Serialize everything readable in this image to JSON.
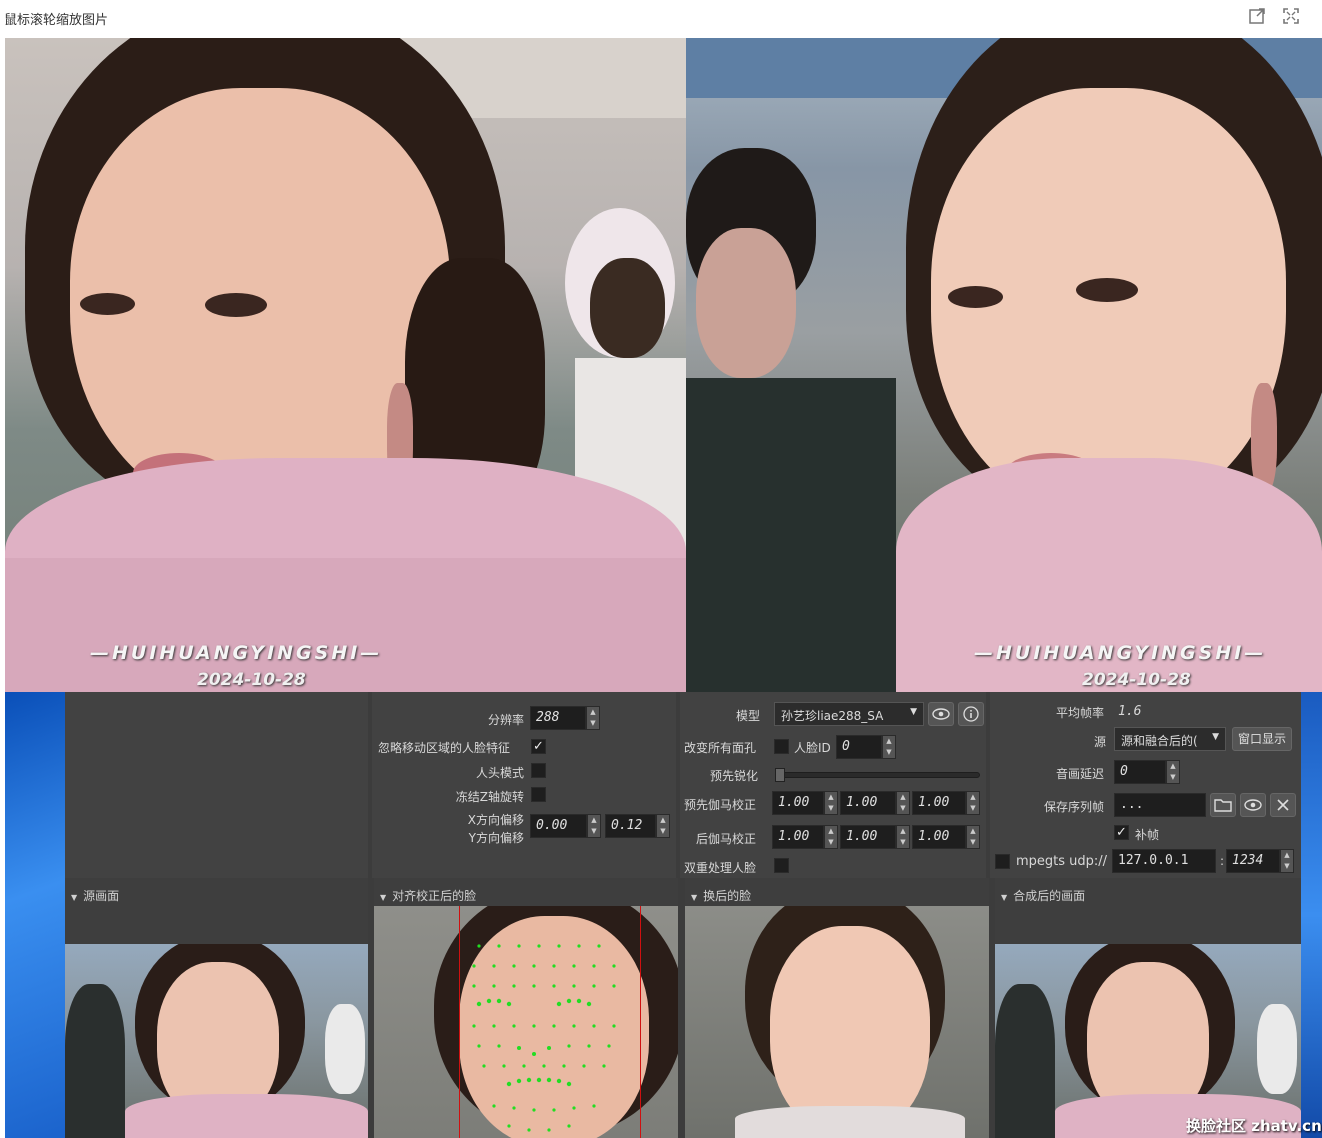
{
  "page": {
    "title": "鼠标滚轮缩放图片"
  },
  "toolbar": {
    "open_icon": "open-external-icon",
    "fullscreen_icon": "fullscreen-icon"
  },
  "preview": {
    "left": {
      "watermark": "—HUIHUANGYINGSHI—",
      "date": "2024-10-28"
    },
    "right": {
      "watermark": "—HUIHUANGYINGSHI—",
      "date": "2024-10-28"
    }
  },
  "settings": {
    "resolution_label": "分辨率",
    "resolution_value": "288",
    "ignore_moving_label": "忽略移动区域的人脸特征",
    "ignore_moving_checked": "✓",
    "head_mode_label": "人头模式",
    "freeze_z_label": "冻结Z轴旋转",
    "x_offset_label": "X方向偏移",
    "y_offset_label": "Y方向偏移",
    "x_offset_value": "0.00",
    "y_offset_value": "0.12",
    "model_label": "模型",
    "model_value": "孙艺珍liae288_SA",
    "change_pupil_label": "改变所有面孔",
    "face_id_label": "人脸ID",
    "face_id_value": "0",
    "pre_sharpen_label": "预先锐化",
    "pre_gamma_label": "预先伽马校正",
    "pre_gamma_values": [
      "1.00",
      "1.00",
      "1.00"
    ],
    "post_gamma_label": "后伽马校正",
    "post_gamma_values": [
      "1.00",
      "1.00",
      "1.00"
    ],
    "dual_process_label": "双重处理人脸",
    "avg_fps_label": "平均帧率",
    "avg_fps_value": "1.6",
    "source_label": "源",
    "source_value": "源和融合后的(",
    "window_button": "窗口显示",
    "audio_delay_label": "音画延迟",
    "audio_delay_value": "0",
    "save_seq_label": "保存序列帧",
    "save_seq_value": "...",
    "fill_frame_label": "补帧",
    "fill_frame_checked": "✓",
    "mpegts_label": "mpegts udp://",
    "mpegts_host": "127.0.0.1",
    "mpegts_sep": ":",
    "mpegts_port": "1234"
  },
  "sections": {
    "source": "源画面",
    "aligned": "对齐校正后的脸",
    "swapped": "换后的脸",
    "merged": "合成后的画面"
  },
  "icons": [
    "eye-icon",
    "info-icon",
    "folder-icon",
    "close-icon",
    "chevron-down-icon"
  ],
  "corner_watermark": "换脸社区 zhatv.cn"
}
